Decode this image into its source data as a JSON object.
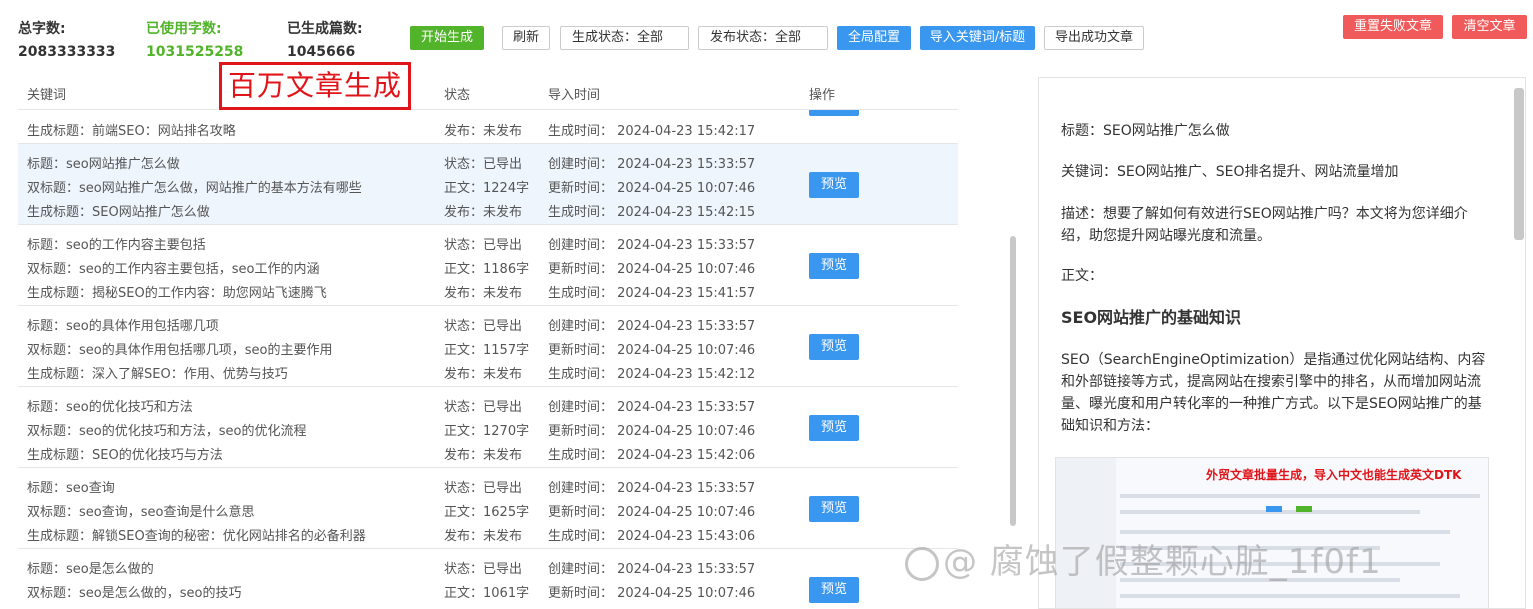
{
  "stats": {
    "total_label": "总字数:",
    "total_value": "2083333333",
    "used_label": "已使用字数:",
    "used_value": "1031525258",
    "generated_label": "已生成篇数:",
    "generated_value": "1045666"
  },
  "toolbar": {
    "start": "开始生成",
    "refresh": "刷新",
    "gen_status": "生成状态：全部",
    "pub_status": "发布状态：全部",
    "global_config": "全局配置",
    "import_keywords": "导入关键词/标题",
    "export_success": "导出成功文章",
    "reset_failed": "重置失败文章",
    "clear_articles": "清空文章"
  },
  "overlay_title": "百万文章生成",
  "table": {
    "headers": {
      "keyword": "关键词",
      "status": "状态",
      "import_time": "导入时间",
      "action": "操作"
    },
    "partial_row": {
      "line": "生成标题：前端SEO：网站排名攻略",
      "status": "发布：未发布",
      "time": "生成时间：  2024-04-23 15:42:17"
    },
    "preview_label": "预览",
    "rows": [
      {
        "title": "标题：seo网站推广怎么做",
        "double": "双标题：seo网站推广怎么做，网站推广的基本方法有哪些",
        "gen": "生成标题：SEO网站推广怎么做",
        "s1": "状态：已导出",
        "s2": "正文：1224字",
        "s3": "发布：未发布",
        "t1": "创建时间：  2024-04-23 15:33:57",
        "t2": "更新时间：  2024-04-25 10:07:46",
        "t3": "生成时间：  2024-04-23 15:42:15"
      },
      {
        "title": "标题：seo的工作内容主要包括",
        "double": "双标题：seo的工作内容主要包括，seo工作的内涵",
        "gen": "生成标题：揭秘SEO的工作内容：助您网站飞速腾飞",
        "s1": "状态：已导出",
        "s2": "正文：1186字",
        "s3": "发布：未发布",
        "t1": "创建时间：  2024-04-23 15:33:57",
        "t2": "更新时间：  2024-04-25 10:07:46",
        "t3": "生成时间：  2024-04-23 15:41:57"
      },
      {
        "title": "标题：seo的具体作用包括哪几项",
        "double": "双标题：seo的具体作用包括哪几项，seo的主要作用",
        "gen": "生成标题：深入了解SEO：作用、优势与技巧",
        "s1": "状态：已导出",
        "s2": "正文：1157字",
        "s3": "发布：未发布",
        "t1": "创建时间：  2024-04-23 15:33:57",
        "t2": "更新时间：  2024-04-25 10:07:46",
        "t3": "生成时间：  2024-04-23 15:42:12"
      },
      {
        "title": "标题：seo的优化技巧和方法",
        "double": "双标题：seo的优化技巧和方法，seo的优化流程",
        "gen": "生成标题：SEO的优化技巧与方法",
        "s1": "状态：已导出",
        "s2": "正文：1270字",
        "s3": "发布：未发布",
        "t1": "创建时间：  2024-04-23 15:33:57",
        "t2": "更新时间：  2024-04-25 10:07:46",
        "t3": "生成时间：  2024-04-23 15:42:06"
      },
      {
        "title": "标题：seo查询",
        "double": "双标题：seo查询，seo查询是什么意思",
        "gen": "生成标题：解锁SEO查询的秘密：优化网站排名的必备利器",
        "s1": "状态：已导出",
        "s2": "正文：1625字",
        "s3": "发布：未发布",
        "t1": "创建时间：  2024-04-23 15:33:57",
        "t2": "更新时间：  2024-04-25 10:07:46",
        "t3": "生成时间：  2024-04-23 15:43:06"
      },
      {
        "title": "标题：seo是怎么做的",
        "double": "双标题：seo是怎么做的，seo的技巧",
        "gen": "",
        "s1": "状态：已导出",
        "s2": "正文：1061字",
        "s3": "",
        "t1": "创建时间：  2024-04-23 15:33:57",
        "t2": "更新时间：  2024-04-25 10:07:46",
        "t3": ""
      }
    ]
  },
  "preview": {
    "title": "标题：SEO网站推广怎么做",
    "keywords": "关键词：SEO网站推广、SEO排名提升、网站流量增加",
    "description": "描述：想要了解如何有效进行SEO网站推广吗？本文将为您详细介绍，助您提升网站曝光度和流量。",
    "body_label": "正文：",
    "heading": "SEO网站推广的基础知识",
    "paragraph": "SEO（SearchEngineOptimization）是指通过优化网站结构、内容和外部链接等方式，提高网站在搜索引擎中的排名，从而增加网站流量、曝光度和用户转化率的一种推广方式。以下是SEO网站推广的基础知识和方法：",
    "image_banner": "外贸文章批量生成，导入中文也能生成英文DTK"
  },
  "watermark": "@ 腐蚀了假整颗心脏_1f0f1"
}
